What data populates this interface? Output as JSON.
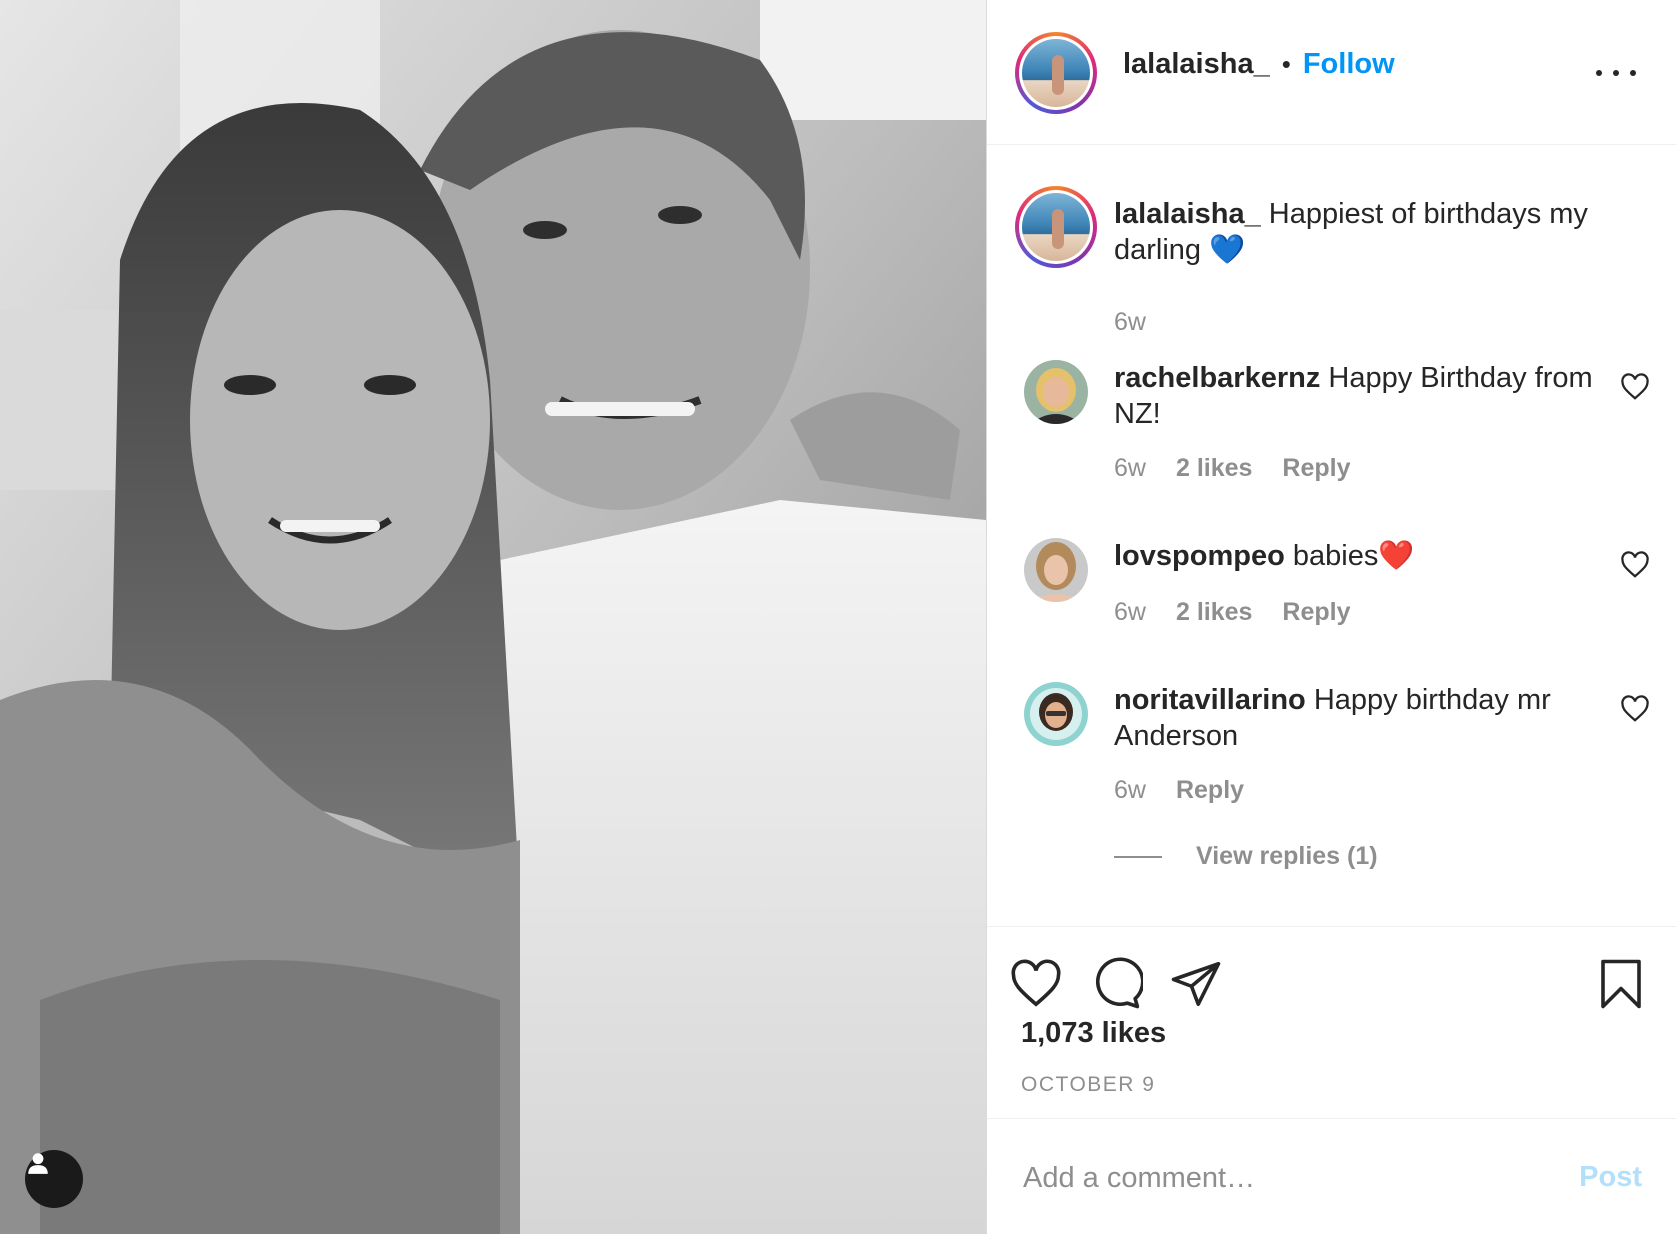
{
  "header": {
    "username": "lalalaisha_",
    "separator": "•",
    "follow_label": "Follow",
    "more_icon": "more-horizontal-icon"
  },
  "caption": {
    "username": "lalalaisha_",
    "text": "Happiest of birthdays my darling 💙",
    "time": "6w"
  },
  "comments": [
    {
      "username": "rachelbarkernz",
      "text": "Happy Birthday from NZ!",
      "time": "6w",
      "likes": "2 likes",
      "reply": "Reply"
    },
    {
      "username": "lovspompeo",
      "text": "babies❤️",
      "time": "6w",
      "likes": "2 likes",
      "reply": "Reply"
    },
    {
      "username": "noritavillarino",
      "text": "Happy birthday mr Anderson",
      "time": "6w",
      "reply": "Reply",
      "view_replies": "View replies (1)"
    }
  ],
  "actions": {
    "icons": [
      "heart-icon",
      "comment-icon",
      "share-icon",
      "bookmark-icon"
    ],
    "likes_count": "1,073 likes",
    "date": "OCTOBER 9"
  },
  "composer": {
    "placeholder": "Add a comment…",
    "post_label": "Post"
  },
  "colors": {
    "link_blue": "#0095f6",
    "muted_gray": "#8e8e8e",
    "post_disabled": "#b2dffc",
    "text": "#262626"
  }
}
